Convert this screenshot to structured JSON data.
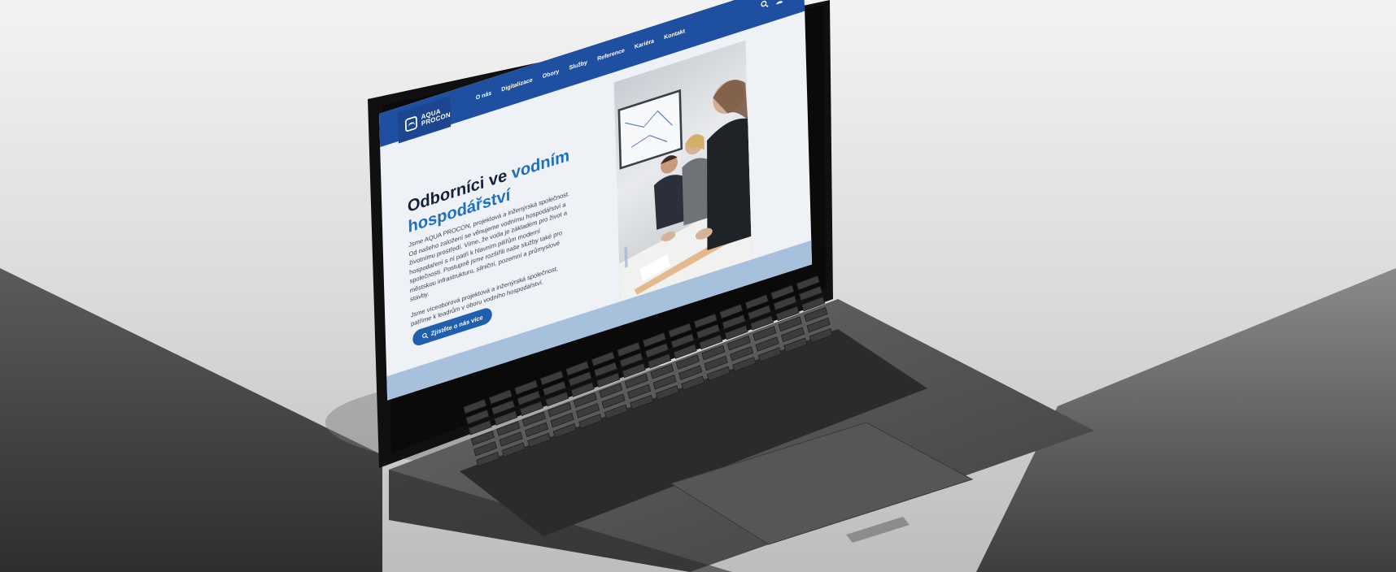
{
  "site": {
    "logo": {
      "line1": "AQUA",
      "line2": "PROCON"
    },
    "nav": [
      {
        "label": "O nás"
      },
      {
        "label": "Digitalizace"
      },
      {
        "label": "Obory"
      },
      {
        "label": "Služby"
      },
      {
        "label": "Reference"
      },
      {
        "label": "Kariéra"
      },
      {
        "label": "Kontakt"
      }
    ],
    "header_icons": [
      "search-icon",
      "user-icon",
      "menu-icon"
    ],
    "hero": {
      "title_part1": "Odborníci ve",
      "title_accent_1": "vodním",
      "title_accent_2": "hospodářství",
      "paragraph_1": "Jsme AQUA PROCON, projektová a inženýrská společnost. Od našeho založení se věnujeme vodnímu hospodářství a životnímu prostředí. Víme, že voda je základem pro život a hospodaření s ní patří k hlavním pilířům moderní společnosti. Postupně jsme rozšířili naše služby také pro městskou infrastrukturu, silniční, pozemní a průmyslové stavby.",
      "paragraph_2": "Jsme víceoborová projektová a inženýrská společnost, patříme k leadrům v oboru vodního hospodářství.",
      "cta_label": "Zjistěte o nás více"
    },
    "colors": {
      "brand_blue": "#1f4fa0",
      "accent_blue": "#1f6fbf",
      "button_blue": "#1f5fae",
      "title_dark": "#16203a"
    }
  }
}
